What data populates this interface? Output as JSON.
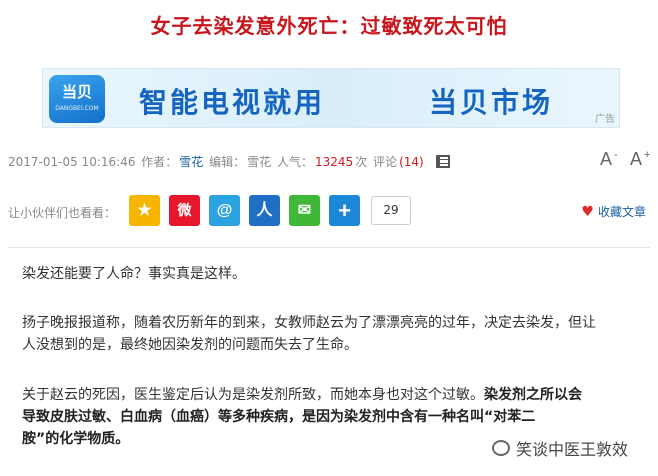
{
  "article": {
    "title": "女子去染发意外死亡：过敏致死太可怕"
  },
  "banner": {
    "logo_text": "当贝",
    "logo_sub": "DANGBEI.COM",
    "text_part1": "智能电视就用",
    "text_part2": "当贝市场",
    "ad_label": "广告",
    "colors": {
      "brand_blue": "#1565c0",
      "logo_bg": "#1370c9"
    }
  },
  "meta": {
    "datetime": "2017-01-05 10:16:46",
    "author_label": "作者：",
    "author": "雪花",
    "editor_label": "编辑：",
    "editor": "雪花",
    "views_label": "人气：",
    "views": "13245",
    "views_unit": "次",
    "comments_label": "评论",
    "comments_count": "(14)",
    "font_smaller": "A",
    "font_smaller_mark": "-",
    "font_larger": "A",
    "font_larger_mark": "+"
  },
  "share": {
    "label": "让小伙伴们也看看：",
    "count": "29",
    "favorite_label": "收藏文章",
    "icons": [
      {
        "name": "qzone-icon",
        "glyph": "★",
        "bg": "#f7b500"
      },
      {
        "name": "weibo-icon",
        "glyph": "微",
        "bg": "#e6162d"
      },
      {
        "name": "tencent-weibo-icon",
        "glyph": "@",
        "bg": "#2aa3e0"
      },
      {
        "name": "renren-icon",
        "glyph": "人",
        "bg": "#1f6fc5"
      },
      {
        "name": "wechat-icon",
        "glyph": "✉",
        "bg": "#3fb838"
      },
      {
        "name": "more-share-icon",
        "glyph": "+",
        "bg": "#1e88d8"
      }
    ]
  },
  "body": {
    "p1": "染发还能要了人命？事实真是这样。",
    "p2_line1": "扬子晚报报道称，随着农历新年的到来，女教师赵云为了漂漂亮亮的过年，决定去染发，但让",
    "p2_line2": "人没想到的是，最终她因染发剂的问题而失去了生命。",
    "p3_normal": "关于赵云的死因，医生鉴定后认为是染发剂所致，而她本身也对这个过敏。",
    "p3_bold_a": "染发剂之所以会",
    "p3_bold_b": "导致皮肤过敏、白血病（血癌）等多种疾病，是因为染发剂中含有一种名叫“对苯二",
    "p3_bold_c": "胺”的化学物质。"
  },
  "watermark": {
    "text": "笑谈中医王敦效"
  }
}
